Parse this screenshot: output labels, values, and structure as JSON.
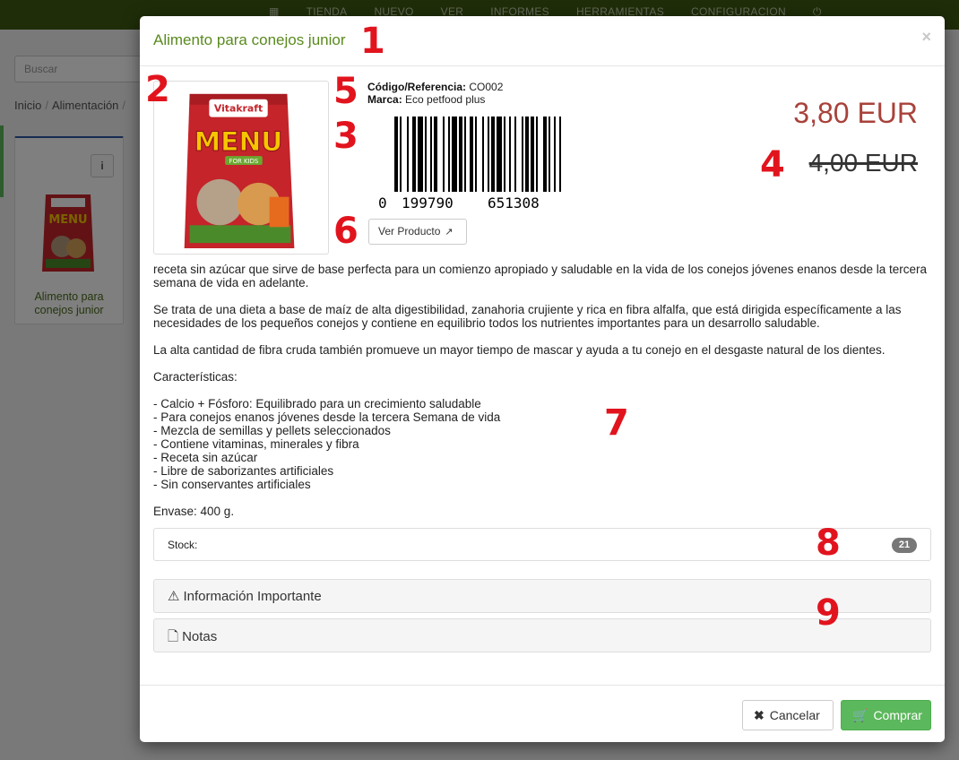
{
  "nav": {
    "grid_icon": "grid-icon",
    "items": [
      "TIENDA",
      "NUEVO",
      "VER",
      "INFORMES",
      "HERRAMIENTAS",
      "CONFIGURACION"
    ],
    "power_icon": "power-icon"
  },
  "background": {
    "search_placeholder": "Buscar",
    "breadcrumb": [
      "Inicio",
      "Alimentación"
    ],
    "card": {
      "info_label": "i",
      "title": "Alimento para conejos junior"
    }
  },
  "modal": {
    "title": "Alimento para conejos junior",
    "close": "×",
    "code_label": "Código/Referencia:",
    "code_value": "CO002",
    "brand_label": "Marca:",
    "brand_value": "Eco petfood plus",
    "barcode_digits": [
      "0",
      "199790",
      "651308"
    ],
    "ver_producto": "Ver Producto",
    "price": "3,80 EUR",
    "old_price": "4,00 EUR",
    "description": [
      "receta sin azúcar que sirve de base perfecta para un comienzo apropiado y saludable en la vida de los conejos jóvenes enanos desde la tercera semana de vida en adelante.",
      "Se trata de una dieta a base de maíz de alta digestibilidad, zanahoria crujiente y rica en fibra alfalfa, que está dirigida específicamente a las necesidades de los pequeños conejos y contiene en equilibrio todos los nutrientes importantes para un desarrollo saludable.",
      "La alta cantidad de fibra cruda también promueve un mayor tiempo de mascar y ayuda a tu conejo en el desgaste natural de los dientes.",
      "Características:"
    ],
    "features": [
      "- Calcio + Fósforo: Equilibrado para un crecimiento saludable",
      "- Para conejos enanos jóvenes desde la tercera Semana de vida",
      "- Mezcla de semillas y pellets seleccionados",
      "- Contiene vitaminas, minerales y fibra",
      "- Receta sin azúcar",
      "- Libre de saborizantes artificiales",
      "- Sin conservantes artificiales"
    ],
    "envase": "Envase: 400 g.",
    "stock_label": "Stock:",
    "stock_count": "21",
    "panel_important": "Información Importante",
    "panel_notes": "Notas",
    "cancel": "Cancelar",
    "buy": "Comprar"
  },
  "callouts": [
    "1",
    "2",
    "3",
    "4",
    "5",
    "6",
    "7",
    "8",
    "9"
  ],
  "colors": {
    "accent_green": "#5a8a1e",
    "price_red": "#a8423b",
    "callout_red": "#e1141e",
    "buy_green": "#5cb85c",
    "topbar": "#3f5a12"
  }
}
